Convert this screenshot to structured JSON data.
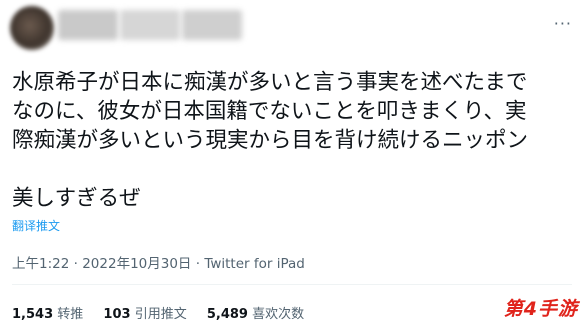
{
  "tweet": {
    "lines": [
      "水原希子が日本に痴漢が多いと言う事実を述べたまで",
      "なのに、彼女が日本国籍でないことを叩きまくり、実",
      "際痴漢が多いという現実から目を背け続けるニッポン"
    ],
    "extra_line": "美しすぎるぜ",
    "translate_label": "翻译推文",
    "time": "上午1:22",
    "date": "2022年10月30日",
    "separator": "·",
    "source": "Twitter for iPad"
  },
  "stats": {
    "retweets": {
      "count": "1,543",
      "label": "转推"
    },
    "quotes": {
      "count": "103",
      "label": "引用推文"
    },
    "likes": {
      "count": "5,489",
      "label": "喜欢次数"
    }
  },
  "watermark": "第4手游",
  "icons": {
    "more": "more-options-icon"
  }
}
